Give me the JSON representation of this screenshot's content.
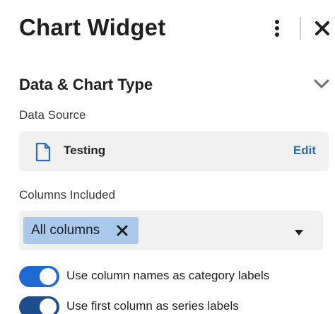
{
  "header": {
    "title": "Chart Widget",
    "menu_icon": "kebab-menu-icon",
    "close_icon": "close-icon"
  },
  "section": {
    "title": "Data & Chart Type",
    "collapse_icon": "chevron-down-icon"
  },
  "data_source": {
    "label": "Data Source",
    "icon": "document-icon",
    "name": "Testing",
    "edit_label": "Edit"
  },
  "columns": {
    "label": "Columns Included",
    "chip_label": "All columns",
    "chip_remove_icon": "close-icon",
    "dropdown_icon": "caret-down-icon"
  },
  "toggles": [
    {
      "label": "Use column names as category labels",
      "on": true
    },
    {
      "label": "Use first column as series labels",
      "on": true
    }
  ],
  "colors": {
    "accent": "#1f6ad2",
    "link": "#2a6cb4",
    "chip": "#a9c8ec",
    "field_bg": "#f1f1f2"
  }
}
